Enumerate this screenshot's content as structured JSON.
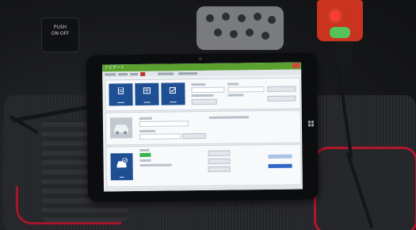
{
  "photo": {
    "push_button": {
      "line1": "PUSH",
      "line2": "ON·OFF"
    },
    "colors": {
      "mat_trim": "#b2162d",
      "obd_body": "#c9331f",
      "obd_led": "#ff3b2f",
      "app_titlebar": "#5aa130",
      "tile_blue": "#1e4f93"
    }
  },
  "tablet_app": {
    "title": "ナビゲート",
    "tiles": [
      {
        "icon": "document-icon"
      },
      {
        "icon": "table-icon"
      },
      {
        "icon": "checklist-icon"
      },
      {
        "icon": "car-checkmark-icon"
      }
    ]
  }
}
